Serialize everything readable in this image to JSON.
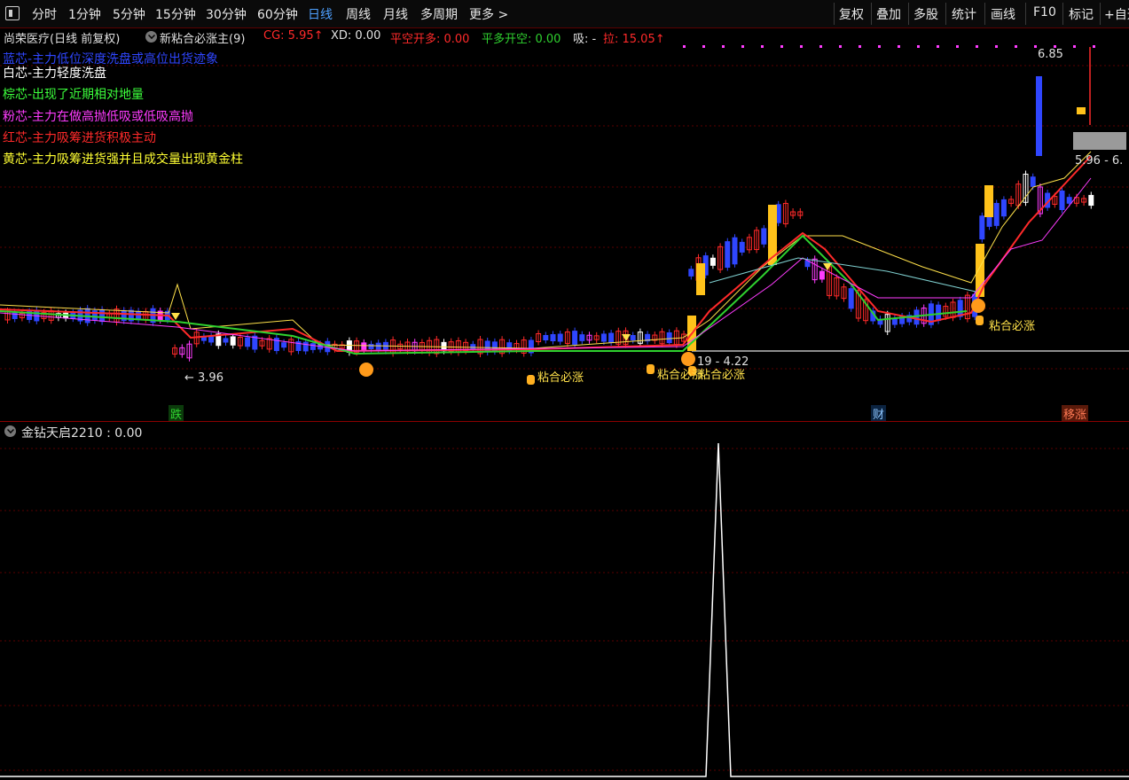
{
  "toolbar": {
    "periods": [
      "分时",
      "1分钟",
      "5分钟",
      "15分钟",
      "30分钟",
      "60分钟",
      "日线",
      "周线",
      "月线",
      "多周期",
      "更多 >"
    ],
    "active_period": "日线",
    "right_buttons": [
      "复权",
      "叠加",
      "多股",
      "统计",
      "画线",
      "F10",
      "标记",
      "+自选"
    ]
  },
  "header": {
    "stock": "尚荣医疗(日线 前复权)",
    "indicator": "新粘合必涨主(9)",
    "cg": "CG: 5.95↑",
    "xd": "XD: 0.00",
    "pkd": "平空开多: 0.00",
    "pdk": "平多开空: 0.00",
    "xi": "吸: -",
    "la": "拉: 15.05↑"
  },
  "legend": [
    {
      "text": "蓝芯-主力低位深度洗盘或高位出货迹象",
      "color": "#2f46ff"
    },
    {
      "text": "白芯-主力轻度洗盘",
      "color": "#ffffff"
    },
    {
      "text": "棕芯-出现了近期相对地量",
      "color": "#3cff3c"
    },
    {
      "text": "粉芯-主力在做高抛低吸或低吸高抛",
      "color": "#ff3cff"
    },
    {
      "text": "红芯-主力吸筹进货积极主动",
      "color": "#ff2a2a"
    },
    {
      "text": "黄芯-主力吸筹进货强并且成交量出现黄金柱",
      "color": "#ffff33"
    }
  ],
  "price_labels": {
    "low": "← 3.96",
    "high": "6.85",
    "range": "5.96 - 6.",
    "mid": "19 - 4.22"
  },
  "signal_label": "粘合必涨",
  "bottom_tags": [
    {
      "text": "跌",
      "color": "#2fd12f",
      "bg": "#0b3b0b"
    },
    {
      "text": "财",
      "color": "#8fc7ff",
      "bg": "#0b2340"
    },
    {
      "text": "移涨",
      "color": "#ff7a55",
      "bg": "#5a1a0a"
    }
  ],
  "indicator_panel": {
    "title": "金钻天启2210 : 0.00"
  },
  "colors": {
    "up": "#ff2a2a",
    "down": "#2f46ff",
    "gold": "#ffc21a",
    "white": "#ffffff",
    "grid": "#5a0000"
  }
}
